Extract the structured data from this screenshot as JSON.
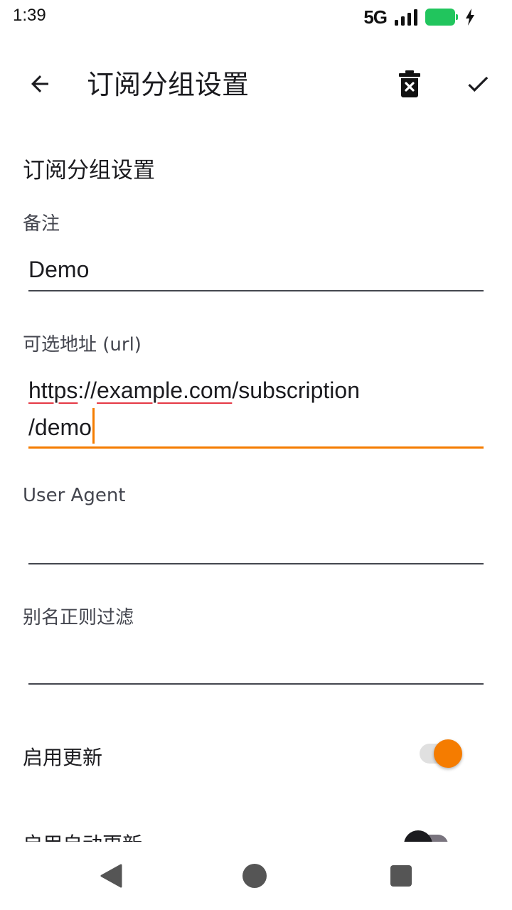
{
  "status_bar": {
    "time": "1:39",
    "network": "5G",
    "battery_color": "#21c55d",
    "icons": [
      "signal-icon",
      "battery-charging-icon"
    ]
  },
  "app_bar": {
    "title": "订阅分组设置",
    "icons": [
      "back-arrow-icon",
      "delete-icon",
      "check-icon"
    ]
  },
  "form": {
    "section_title": "订阅分组设置",
    "remark_label": "备注",
    "remark_value": "Demo",
    "url_label": "可选地址 (url)",
    "url_value_parts": [
      "https",
      "://",
      "example.com",
      "/subscription",
      "/demo"
    ],
    "user_agent_label": "User Agent",
    "user_agent_value": "",
    "alias_filter_label": "别名正则过滤",
    "alias_filter_value": "",
    "enable_update_label": "启用更新",
    "enable_update_on": true,
    "enable_auto_update_label": "启用自动更新",
    "enable_auto_update_on": false,
    "accent_color": "#f57c00",
    "spellcheck_color": "#e53945"
  },
  "nav_bar": {
    "icons": [
      "nav-back-icon",
      "nav-home-icon",
      "nav-recents-icon"
    ]
  }
}
